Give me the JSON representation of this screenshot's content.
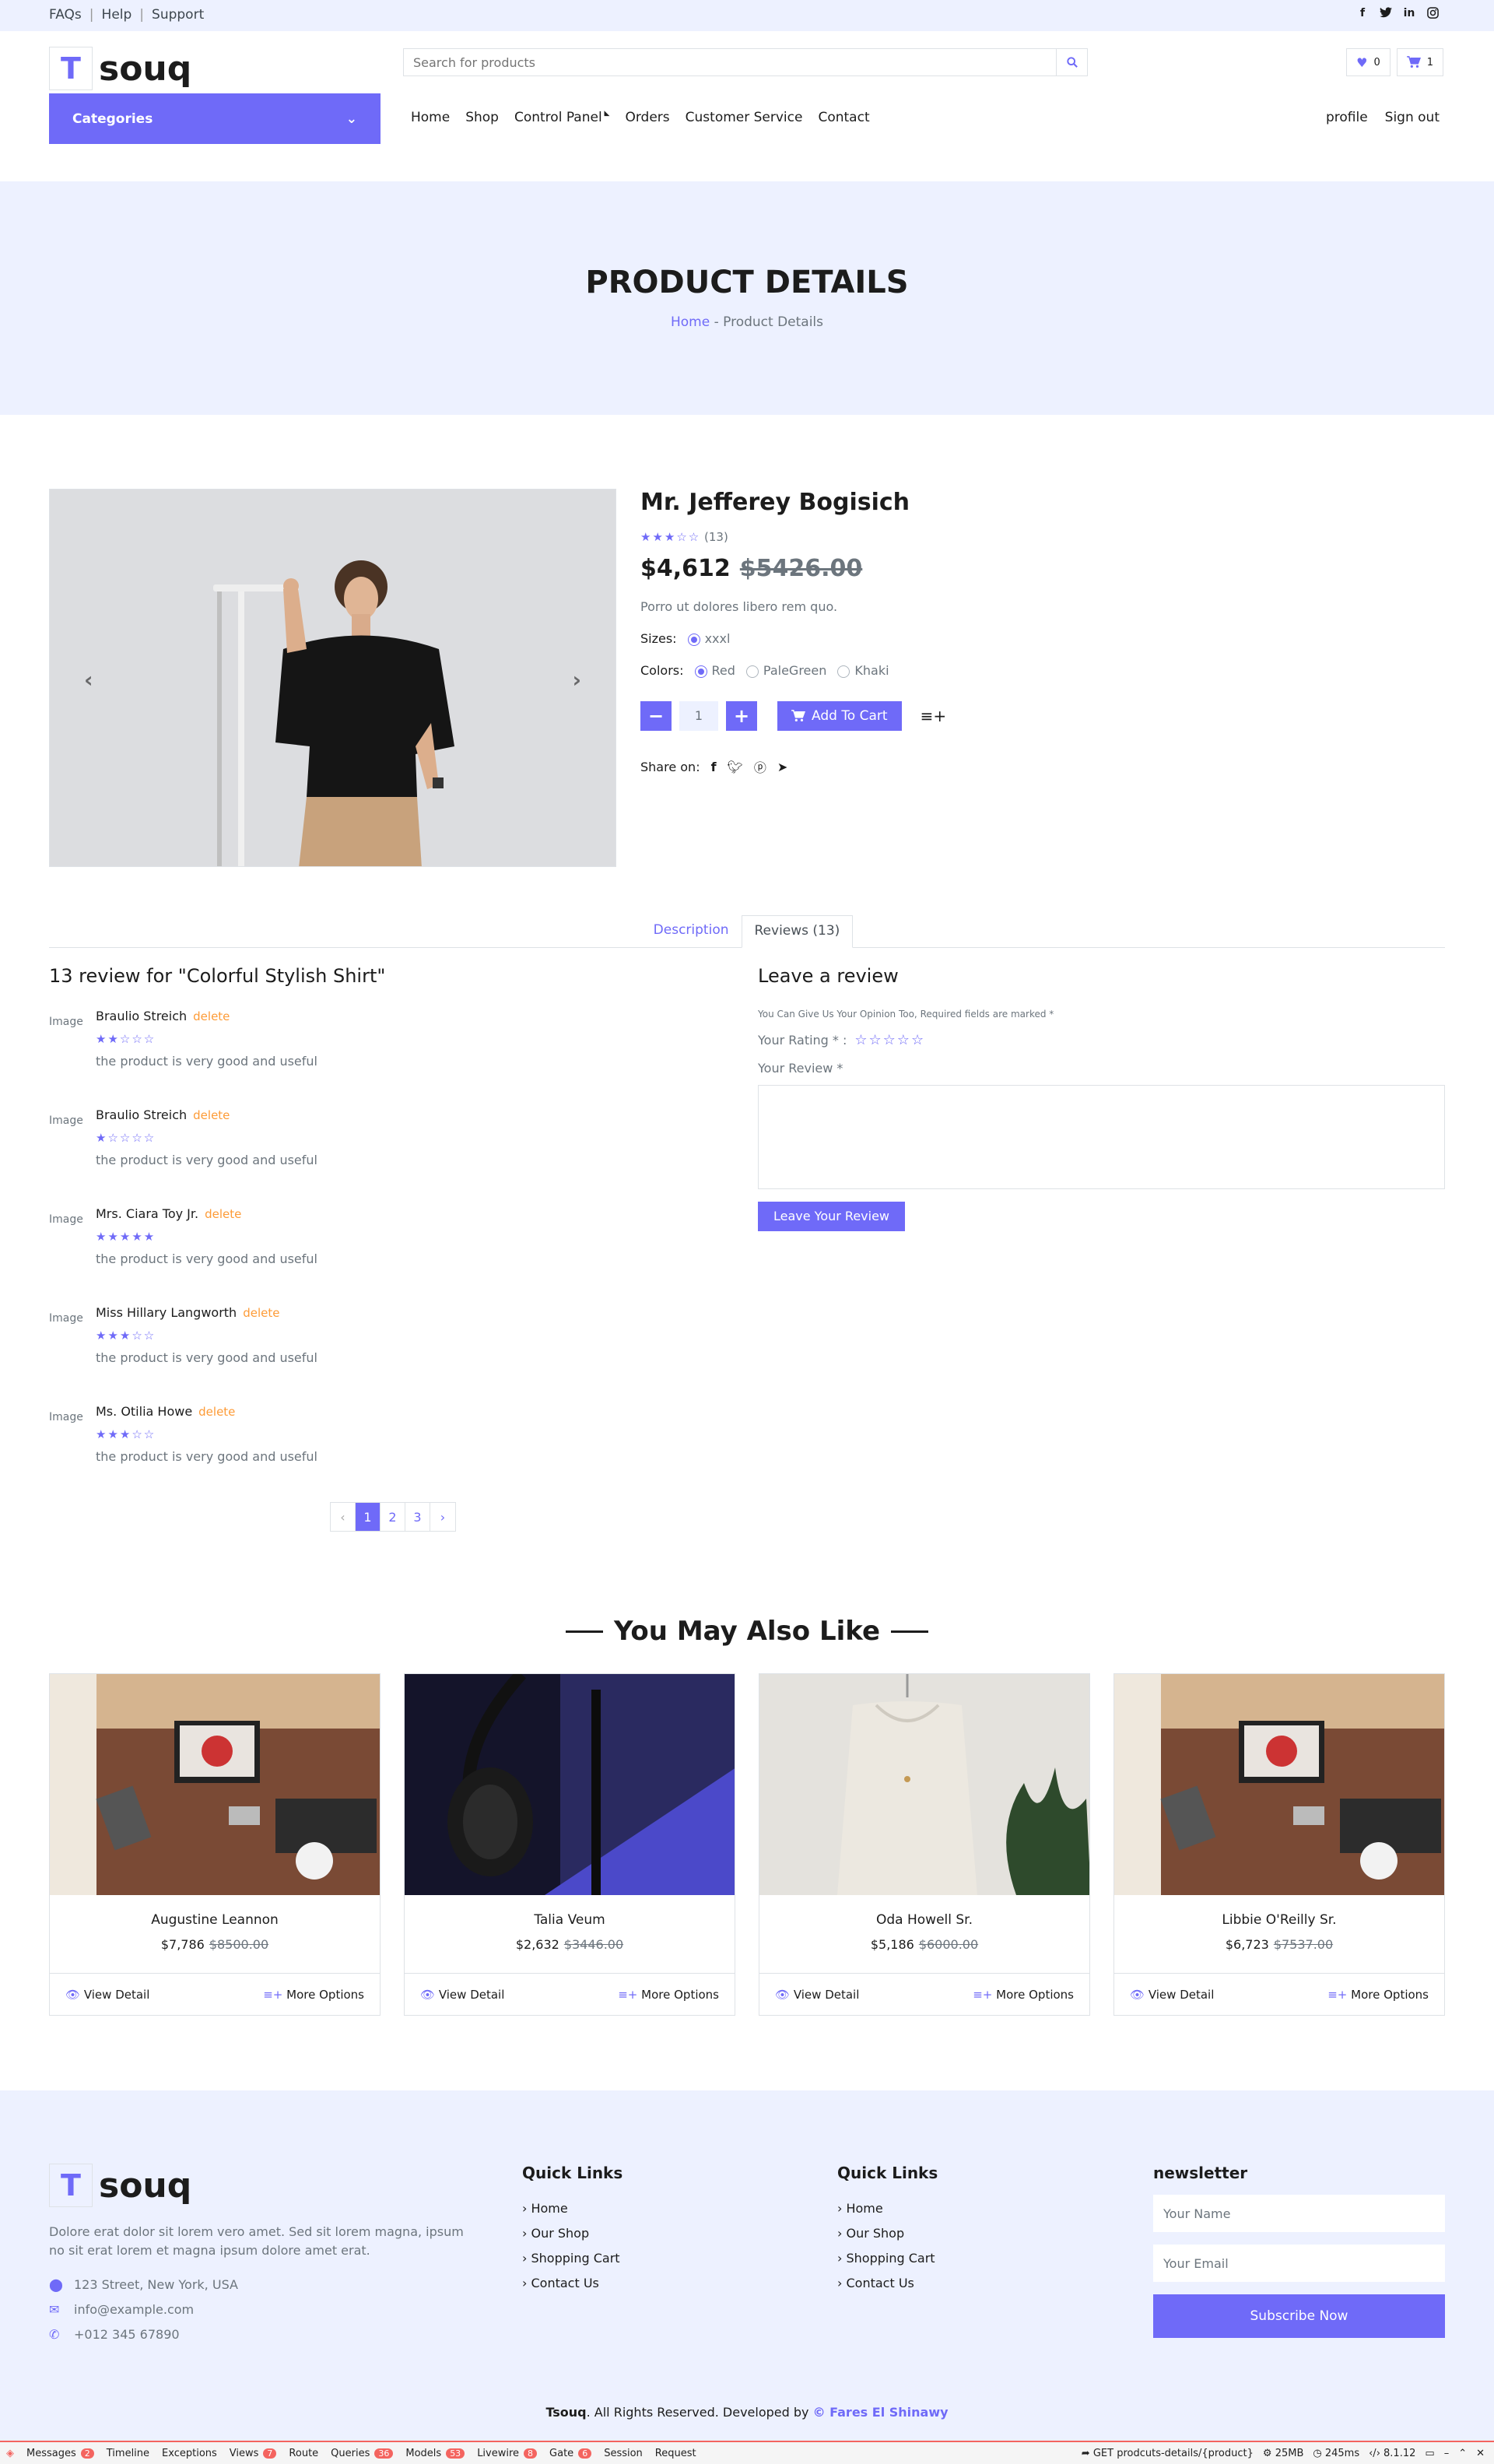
{
  "topbar": {
    "links": [
      "FAQs",
      "Help",
      "Support"
    ],
    "social_icons": [
      "facebook-icon",
      "twitter-icon",
      "linkedin-icon",
      "instagram-icon"
    ]
  },
  "header": {
    "logo_letter": "T",
    "logo_name": "souq",
    "search_placeholder": "Search for products",
    "wishlist_count": "0",
    "cart_count": "1"
  },
  "nav": {
    "categories_label": "Categories",
    "menu": [
      "Home",
      "Shop",
      "Control Panel",
      "Orders",
      "Customer Service",
      "Contact"
    ],
    "right": [
      "profile",
      "Sign out"
    ]
  },
  "banner": {
    "title": "PRODUCT DETAILS",
    "crumb_home": "Home",
    "crumb_sep": "-",
    "crumb_current": "Product Details"
  },
  "product": {
    "name": "Mr. Jefferey Bogisich",
    "rating": 3,
    "reviews_count": "(13)",
    "price": "$4,612",
    "old_price": "$5426.00",
    "description": "Porro ut dolores libero rem quo.",
    "sizes_label": "Sizes:",
    "sizes": [
      "xxxl"
    ],
    "colors_label": "Colors:",
    "colors": [
      "Red",
      "PaleGreen",
      "Khaki"
    ],
    "quantity": "1",
    "add_to_cart": "Add To Cart",
    "share_label": "Share on:"
  },
  "tabs": [
    "Description",
    "Reviews (13)"
  ],
  "reviews": {
    "heading": "13 review for \"Colorful Stylish Shirt\"",
    "avatar_alt": "Image",
    "delete_label": "delete",
    "items": [
      {
        "name": "Braulio Streich",
        "stars": 2,
        "text": "the product is very good and useful"
      },
      {
        "name": "Braulio Streich",
        "stars": 1,
        "text": "the product is very good and useful"
      },
      {
        "name": "Mrs. Ciara Toy Jr.",
        "stars": 5,
        "text": "the product is very good and useful"
      },
      {
        "name": "Miss Hillary Langworth",
        "stars": 3,
        "text": "the product is very good and useful"
      },
      {
        "name": "Ms. Otilia Howe",
        "stars": 3,
        "text": "the product is very good and useful"
      }
    ],
    "pages": [
      "‹",
      "1",
      "2",
      "3",
      "›"
    ]
  },
  "leave_review": {
    "title": "Leave a review",
    "note": "You Can Give Us Your Opinion Too, Required fields are marked *",
    "rating_label": "Your Rating * :",
    "review_label": "Your Review *",
    "submit": "Leave Your Review"
  },
  "also": {
    "title": "You May Also Like",
    "items": [
      {
        "name": "Augustine Leannon",
        "price": "$7,786",
        "old": "$8500.00"
      },
      {
        "name": "Talia Veum",
        "price": "$2,632",
        "old": "$3446.00"
      },
      {
        "name": "Oda Howell Sr.",
        "price": "$5,186",
        "old": "$6000.00"
      },
      {
        "name": "Libbie O'Reilly Sr.",
        "price": "$6,723",
        "old": "$7537.00"
      }
    ],
    "view_label": "View Detail",
    "more_label": "More Options"
  },
  "footer": {
    "desc": "Dolore erat dolor sit lorem vero amet. Sed sit lorem magna, ipsum no sit erat lorem et magna ipsum dolore amet erat.",
    "address": "123 Street, New York, USA",
    "email": "info@example.com",
    "phone": "+012 345 67890",
    "quick_title": "Quick Links",
    "links": [
      "Home",
      "Our Shop",
      "Shopping Cart",
      "Contact Us"
    ],
    "news_title": "newsletter",
    "name_ph": "Your Name",
    "email_ph": "Your Email",
    "subscribe": "Subscribe Now",
    "copy_brand": "Tsouq",
    "copy_text": ". All Rights Reserved. Developed by ",
    "copy_author": "© Fares El Shinawy"
  },
  "debugbar": {
    "items": [
      {
        "label": "Messages",
        "badge": "2"
      },
      {
        "label": "Timeline",
        "badge": ""
      },
      {
        "label": "Exceptions",
        "badge": ""
      },
      {
        "label": "Views",
        "badge": "7"
      },
      {
        "label": "Route",
        "badge": ""
      },
      {
        "label": "Queries",
        "badge": "36"
      },
      {
        "label": "Models",
        "badge": "53"
      },
      {
        "label": "Livewire",
        "badge": "8"
      },
      {
        "label": "Gate",
        "badge": "6"
      },
      {
        "label": "Session",
        "badge": ""
      },
      {
        "label": "Request",
        "badge": ""
      }
    ],
    "route": "GET prodcuts-details/{product}",
    "memory": "25MB",
    "time": "245ms",
    "php": "8.1.12"
  },
  "colors": {
    "accent": "#6f6af8",
    "light_bg": "#edf1ff",
    "delete": "#fd9b37"
  }
}
